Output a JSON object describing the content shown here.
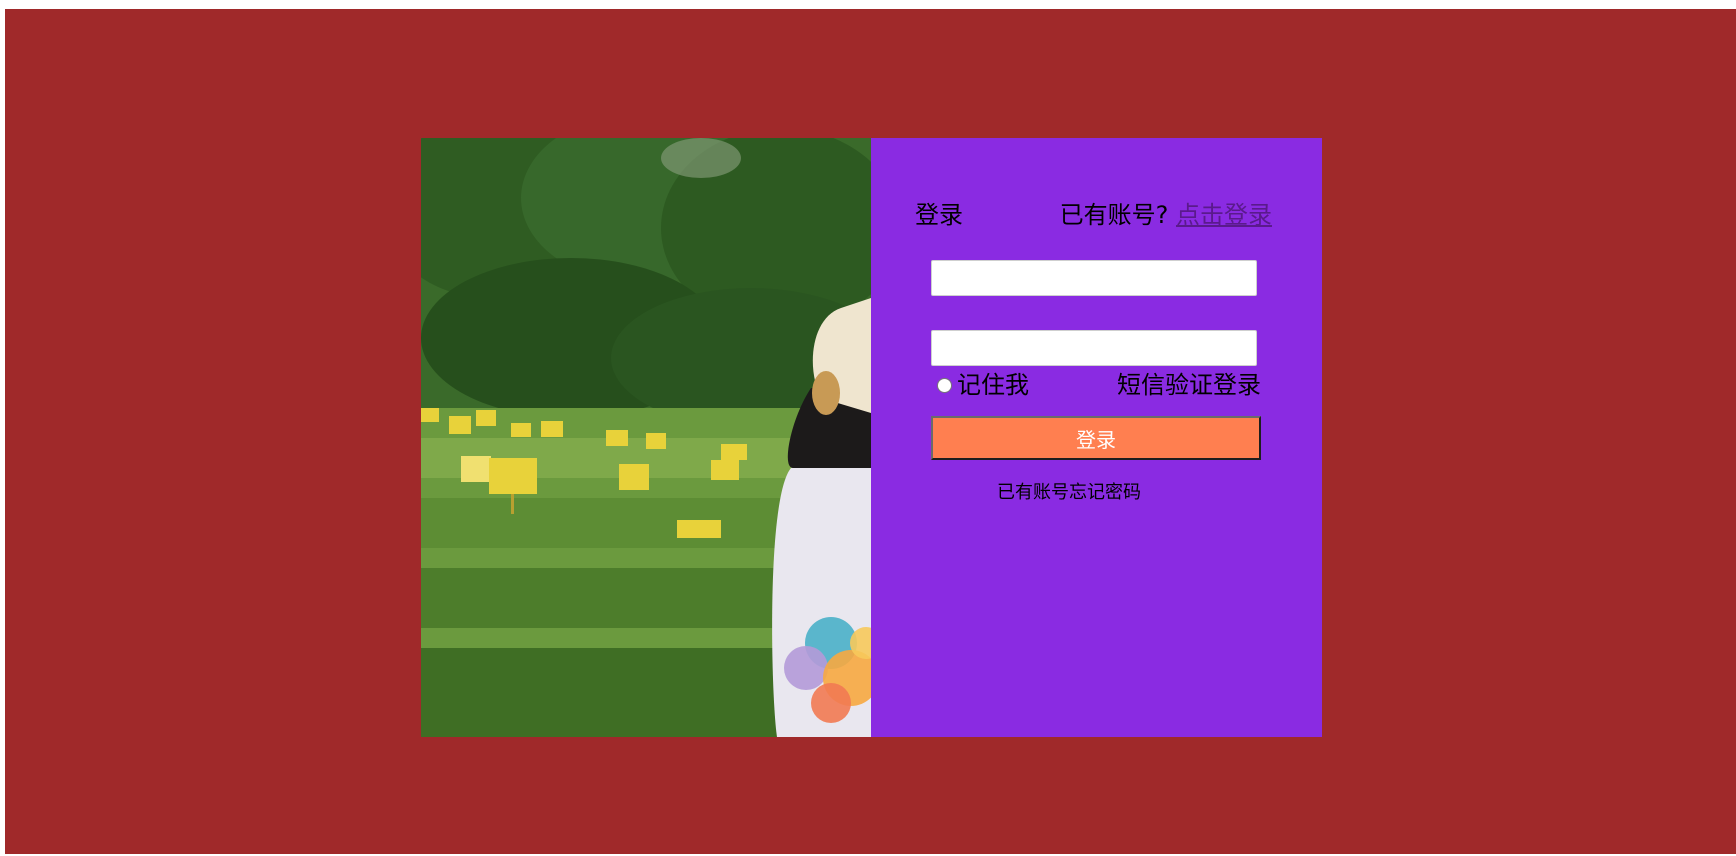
{
  "login_form": {
    "title": "登录",
    "account_prompt": "已有账号?",
    "login_link": "点击登录",
    "username_value": "",
    "password_value": "",
    "remember_label": "记住我",
    "sms_login": "短信验证登录",
    "submit_label": "登录",
    "forgot_text": "已有账号忘记密码"
  },
  "colors": {
    "page_background": "#a0292a",
    "form_background": "#8a2be2",
    "button_background": "#ff7f50",
    "link_color": "#5a1a8c"
  },
  "icons": {
    "remember_radio": "radio-unchecked-icon",
    "photo": "tea-field-girl-photo"
  }
}
